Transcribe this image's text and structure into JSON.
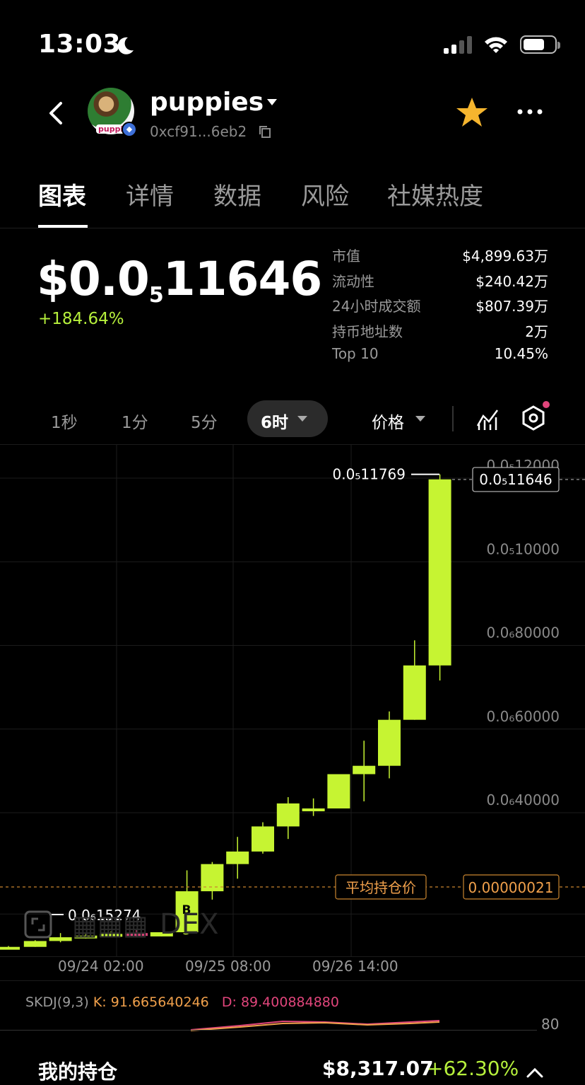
{
  "status_bar": {
    "time": "13:03",
    "icons": [
      "moon-icon",
      "signal-icon",
      "wifi-icon",
      "battery-icon"
    ]
  },
  "header": {
    "token_name": "puppies",
    "avatar_tag": "puppie",
    "address": "0xcf91...6eb2",
    "favorite_color": "#f5b52e"
  },
  "tabs": [
    "图表",
    "详情",
    "数据",
    "风险",
    "社媒热度"
  ],
  "price": {
    "main": "$0.0",
    "subscript": "5",
    "tail": "11646",
    "change": "+184.64%"
  },
  "stats": [
    {
      "label": "市值",
      "value": "$4,899.63万"
    },
    {
      "label": "流动性",
      "value": "$240.42万"
    },
    {
      "label": "24小时成交额",
      "value": "$807.39万"
    },
    {
      "label": "持币地址数",
      "value": "2万"
    },
    {
      "label": "Top 10",
      "value": "10.45%"
    }
  ],
  "timeframes": [
    "1秒",
    "1分",
    "5分"
  ],
  "timeframe_active": "6时",
  "price_select": "价格",
  "chart_data": {
    "type": "candlestick",
    "y_axis_labels": [
      "0.0₅12000",
      "0.0₅10000",
      "0.0₆80000",
      "0.0₆60000",
      "0.0₆40000"
    ],
    "y_axis_values": [
      0.00012,
      0.0001,
      8e-05,
      6e-05,
      4e-05
    ],
    "ylim": [
      2.5e-06,
      0.0001265
    ],
    "x_axis_labels": [
      "09/24 02:00",
      "09/25 08:00",
      "09/26 14:00"
    ],
    "current_price_label": "0.0₅11646",
    "current_price": 0.00011646,
    "high_label": "0.0₅11769",
    "high": 0.00011769,
    "low_label": "0.0₆15274",
    "low": 1.5274e-06,
    "avg_cost_label": "平均持仓价",
    "avg_cost_value": "0.00000021",
    "avg_cost_level": 2.1e-05,
    "buy_marker": {
      "letter": "B",
      "count": "3"
    },
    "watermark": "DEX",
    "up_color": "#c6f432",
    "down_color": "#e0457b",
    "candles": [
      {
        "o": 4.7e-06,
        "h": 4.9e-06,
        "l": 4.6e-06,
        "c": 4.7e-06
      },
      {
        "o": 4.7e-06,
        "h": 6.3e-06,
        "l": 4.7e-06,
        "c": 6.1e-06
      },
      {
        "o": 6.1e-06,
        "h": 8e-06,
        "l": 5.8e-06,
        "c": 7e-06
      },
      {
        "o": 7e-06,
        "h": 7.8e-06,
        "l": 6.7e-06,
        "c": 7.4e-06
      },
      {
        "o": 7.4e-06,
        "h": 8.4e-06,
        "l": 7e-06,
        "c": 7.8e-06
      },
      {
        "o": 8e-06,
        "h": 8.8e-06,
        "l": 7.2e-06,
        "c": 7.5e-06
      },
      {
        "o": 7.2e-06,
        "h": 8.2e-06,
        "l": 7.2e-06,
        "c": 8.2e-06
      },
      {
        "o": 8.2e-06,
        "h": 2.3e-05,
        "l": 7.8e-06,
        "c": 1.8e-05
      },
      {
        "o": 1.8e-05,
        "h": 2.5e-05,
        "l": 1.6e-05,
        "c": 2.45e-05
      },
      {
        "o": 2.45e-05,
        "h": 3.1e-05,
        "l": 2.1e-05,
        "c": 2.75e-05
      },
      {
        "o": 2.75e-05,
        "h": 3.45e-05,
        "l": 2.7e-05,
        "c": 3.35e-05
      },
      {
        "o": 3.35e-05,
        "h": 4.05e-05,
        "l": 3.05e-05,
        "c": 3.9e-05
      },
      {
        "o": 3.78e-05,
        "h": 4.02e-05,
        "l": 3.6e-05,
        "c": 3.78e-05
      },
      {
        "o": 3.78e-05,
        "h": 4.3e-05,
        "l": 3.78e-05,
        "c": 4.6e-05
      },
      {
        "o": 4.6e-05,
        "h": 5.4e-05,
        "l": 3.95e-05,
        "c": 4.8e-05
      },
      {
        "o": 4.8e-05,
        "h": 6.1e-05,
        "l": 4.5e-05,
        "c": 5.9e-05
      },
      {
        "o": 5.9e-05,
        "h": 7.8e-05,
        "l": 5.9e-05,
        "c": 7.2e-05
      },
      {
        "o": 7.2e-05,
        "h": 0.0001177,
        "l": 6.84e-05,
        "c": 0.0001165
      }
    ]
  },
  "skdj": {
    "label": "SKDJ(9,3)",
    "k": "K: 91.665640246",
    "d": "D: 89.400884880",
    "level": "80"
  },
  "holdings": {
    "label": "我的持仓",
    "value": "$8,317.07",
    "change": "+62.30%"
  }
}
